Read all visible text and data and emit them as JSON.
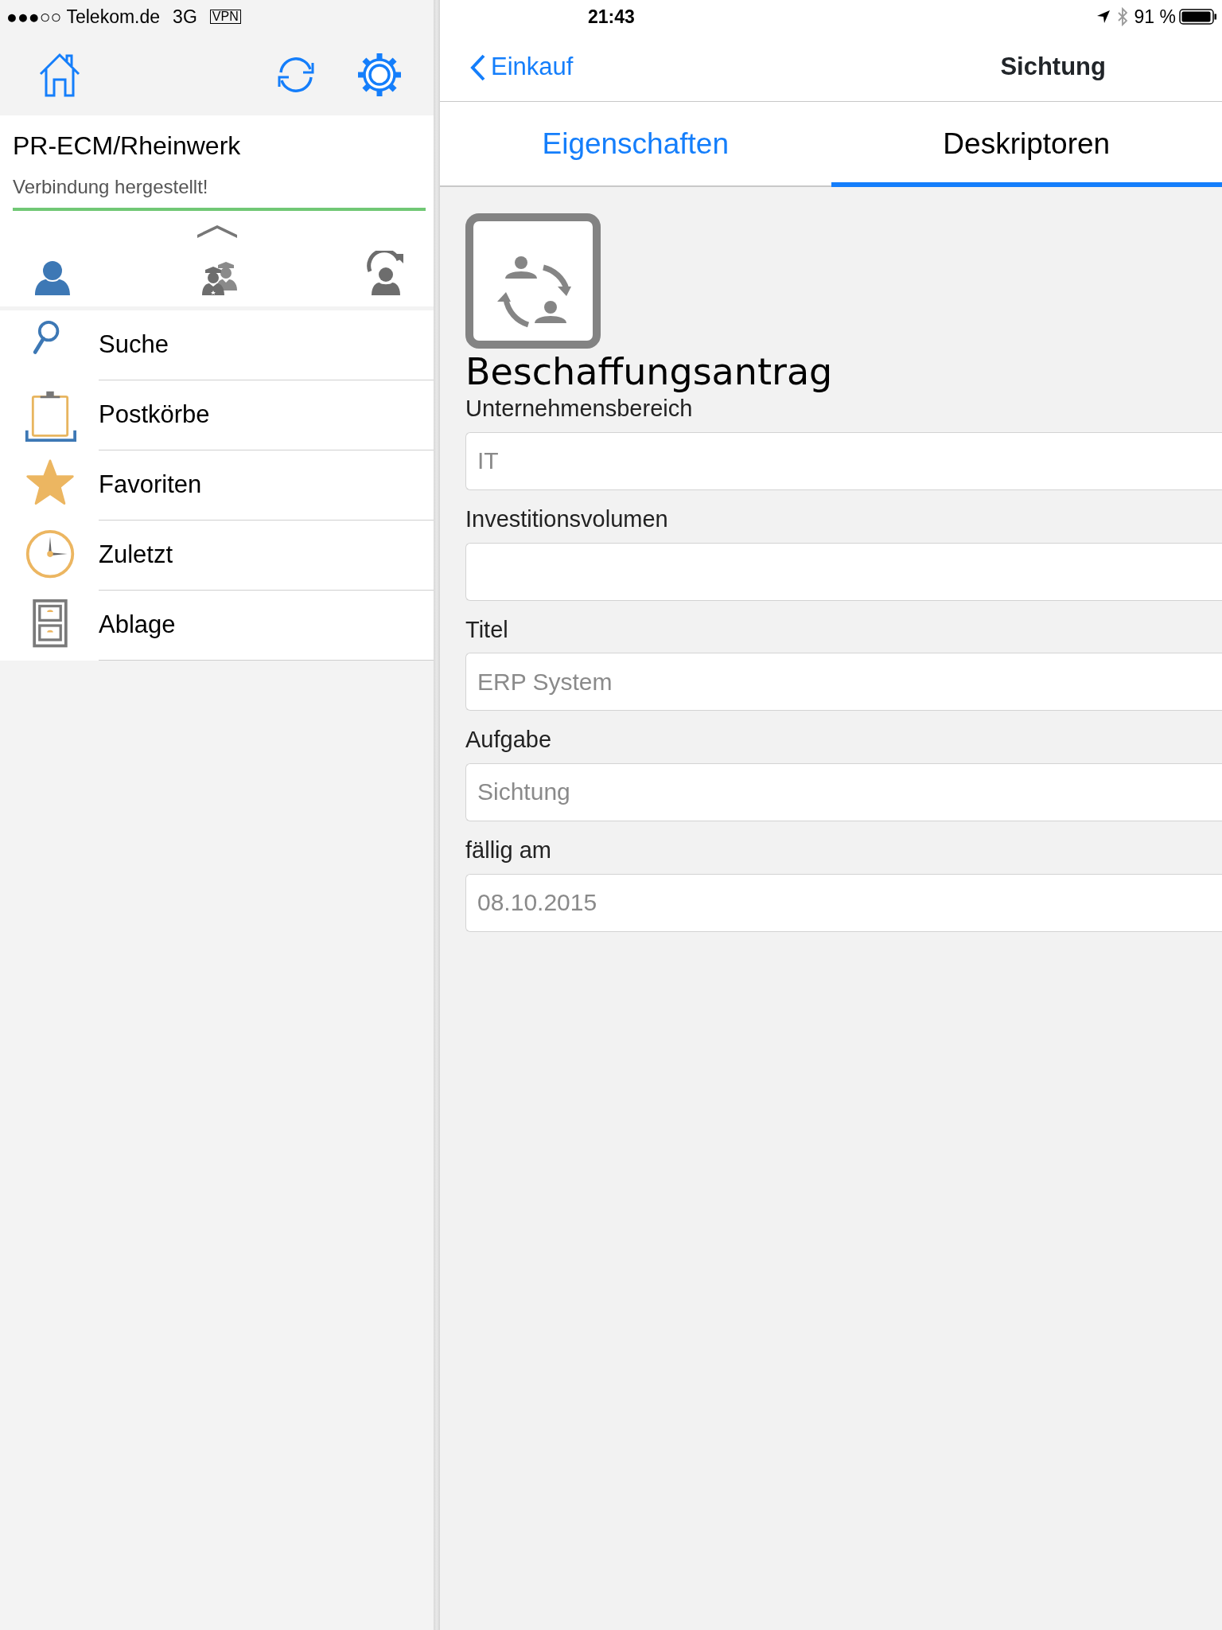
{
  "status_bar": {
    "signal": "●●●○○",
    "carrier": "Telekom.de",
    "network": "3G",
    "vpn": "VPN",
    "time": "21:43",
    "battery": "91 %"
  },
  "sidebar": {
    "server": "PR-ECM/Rheinwerk",
    "connection_status": "Verbindung hergestellt!",
    "profiles": [
      {
        "kind": "user",
        "selected": true
      },
      {
        "kind": "group",
        "selected": false
      },
      {
        "kind": "substitute",
        "selected": false
      }
    ],
    "items": [
      {
        "kind": "search",
        "label": "Suche"
      },
      {
        "kind": "inbox",
        "label": "Postkörbe"
      },
      {
        "kind": "favorites",
        "label": "Favoriten"
      },
      {
        "kind": "recent",
        "label": "Zuletzt"
      },
      {
        "kind": "archive",
        "label": "Ablage"
      }
    ]
  },
  "nav": {
    "back": "Einkauf",
    "title": "Sichtung"
  },
  "tabs": [
    {
      "label": "Eigenschaften",
      "selected": false
    },
    {
      "label": "Deskriptoren",
      "selected": true
    }
  ],
  "document": {
    "title": "Beschaffungsantrag",
    "fields": [
      {
        "label": "Unternehmensbereich",
        "value": "IT"
      },
      {
        "label": "Investitionsvolumen"
      },
      {
        "label": "Titel",
        "value": "ERP System"
      },
      {
        "label": "Aufgabe",
        "value": "Sichtung"
      },
      {
        "label": "fällig am",
        "value": "08.10.2015"
      }
    ]
  }
}
